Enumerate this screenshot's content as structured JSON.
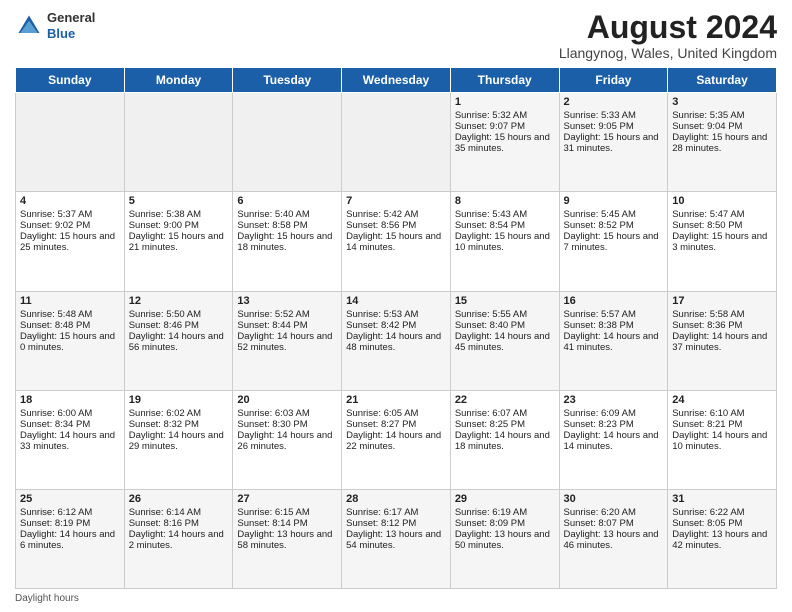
{
  "header": {
    "logo_line1": "General",
    "logo_line2": "Blue",
    "main_title": "August 2024",
    "subtitle": "Llangynog, Wales, United Kingdom"
  },
  "days_of_week": [
    "Sunday",
    "Monday",
    "Tuesday",
    "Wednesday",
    "Thursday",
    "Friday",
    "Saturday"
  ],
  "weeks": [
    [
      {
        "day": "",
        "sunrise": "",
        "sunset": "",
        "daylight": ""
      },
      {
        "day": "",
        "sunrise": "",
        "sunset": "",
        "daylight": ""
      },
      {
        "day": "",
        "sunrise": "",
        "sunset": "",
        "daylight": ""
      },
      {
        "day": "",
        "sunrise": "",
        "sunset": "",
        "daylight": ""
      },
      {
        "day": "1",
        "sunrise": "Sunrise: 5:32 AM",
        "sunset": "Sunset: 9:07 PM",
        "daylight": "Daylight: 15 hours and 35 minutes."
      },
      {
        "day": "2",
        "sunrise": "Sunrise: 5:33 AM",
        "sunset": "Sunset: 9:05 PM",
        "daylight": "Daylight: 15 hours and 31 minutes."
      },
      {
        "day": "3",
        "sunrise": "Sunrise: 5:35 AM",
        "sunset": "Sunset: 9:04 PM",
        "daylight": "Daylight: 15 hours and 28 minutes."
      }
    ],
    [
      {
        "day": "4",
        "sunrise": "Sunrise: 5:37 AM",
        "sunset": "Sunset: 9:02 PM",
        "daylight": "Daylight: 15 hours and 25 minutes."
      },
      {
        "day": "5",
        "sunrise": "Sunrise: 5:38 AM",
        "sunset": "Sunset: 9:00 PM",
        "daylight": "Daylight: 15 hours and 21 minutes."
      },
      {
        "day": "6",
        "sunrise": "Sunrise: 5:40 AM",
        "sunset": "Sunset: 8:58 PM",
        "daylight": "Daylight: 15 hours and 18 minutes."
      },
      {
        "day": "7",
        "sunrise": "Sunrise: 5:42 AM",
        "sunset": "Sunset: 8:56 PM",
        "daylight": "Daylight: 15 hours and 14 minutes."
      },
      {
        "day": "8",
        "sunrise": "Sunrise: 5:43 AM",
        "sunset": "Sunset: 8:54 PM",
        "daylight": "Daylight: 15 hours and 10 minutes."
      },
      {
        "day": "9",
        "sunrise": "Sunrise: 5:45 AM",
        "sunset": "Sunset: 8:52 PM",
        "daylight": "Daylight: 15 hours and 7 minutes."
      },
      {
        "day": "10",
        "sunrise": "Sunrise: 5:47 AM",
        "sunset": "Sunset: 8:50 PM",
        "daylight": "Daylight: 15 hours and 3 minutes."
      }
    ],
    [
      {
        "day": "11",
        "sunrise": "Sunrise: 5:48 AM",
        "sunset": "Sunset: 8:48 PM",
        "daylight": "Daylight: 15 hours and 0 minutes."
      },
      {
        "day": "12",
        "sunrise": "Sunrise: 5:50 AM",
        "sunset": "Sunset: 8:46 PM",
        "daylight": "Daylight: 14 hours and 56 minutes."
      },
      {
        "day": "13",
        "sunrise": "Sunrise: 5:52 AM",
        "sunset": "Sunset: 8:44 PM",
        "daylight": "Daylight: 14 hours and 52 minutes."
      },
      {
        "day": "14",
        "sunrise": "Sunrise: 5:53 AM",
        "sunset": "Sunset: 8:42 PM",
        "daylight": "Daylight: 14 hours and 48 minutes."
      },
      {
        "day": "15",
        "sunrise": "Sunrise: 5:55 AM",
        "sunset": "Sunset: 8:40 PM",
        "daylight": "Daylight: 14 hours and 45 minutes."
      },
      {
        "day": "16",
        "sunrise": "Sunrise: 5:57 AM",
        "sunset": "Sunset: 8:38 PM",
        "daylight": "Daylight: 14 hours and 41 minutes."
      },
      {
        "day": "17",
        "sunrise": "Sunrise: 5:58 AM",
        "sunset": "Sunset: 8:36 PM",
        "daylight": "Daylight: 14 hours and 37 minutes."
      }
    ],
    [
      {
        "day": "18",
        "sunrise": "Sunrise: 6:00 AM",
        "sunset": "Sunset: 8:34 PM",
        "daylight": "Daylight: 14 hours and 33 minutes."
      },
      {
        "day": "19",
        "sunrise": "Sunrise: 6:02 AM",
        "sunset": "Sunset: 8:32 PM",
        "daylight": "Daylight: 14 hours and 29 minutes."
      },
      {
        "day": "20",
        "sunrise": "Sunrise: 6:03 AM",
        "sunset": "Sunset: 8:30 PM",
        "daylight": "Daylight: 14 hours and 26 minutes."
      },
      {
        "day": "21",
        "sunrise": "Sunrise: 6:05 AM",
        "sunset": "Sunset: 8:27 PM",
        "daylight": "Daylight: 14 hours and 22 minutes."
      },
      {
        "day": "22",
        "sunrise": "Sunrise: 6:07 AM",
        "sunset": "Sunset: 8:25 PM",
        "daylight": "Daylight: 14 hours and 18 minutes."
      },
      {
        "day": "23",
        "sunrise": "Sunrise: 6:09 AM",
        "sunset": "Sunset: 8:23 PM",
        "daylight": "Daylight: 14 hours and 14 minutes."
      },
      {
        "day": "24",
        "sunrise": "Sunrise: 6:10 AM",
        "sunset": "Sunset: 8:21 PM",
        "daylight": "Daylight: 14 hours and 10 minutes."
      }
    ],
    [
      {
        "day": "25",
        "sunrise": "Sunrise: 6:12 AM",
        "sunset": "Sunset: 8:19 PM",
        "daylight": "Daylight: 14 hours and 6 minutes."
      },
      {
        "day": "26",
        "sunrise": "Sunrise: 6:14 AM",
        "sunset": "Sunset: 8:16 PM",
        "daylight": "Daylight: 14 hours and 2 minutes."
      },
      {
        "day": "27",
        "sunrise": "Sunrise: 6:15 AM",
        "sunset": "Sunset: 8:14 PM",
        "daylight": "Daylight: 13 hours and 58 minutes."
      },
      {
        "day": "28",
        "sunrise": "Sunrise: 6:17 AM",
        "sunset": "Sunset: 8:12 PM",
        "daylight": "Daylight: 13 hours and 54 minutes."
      },
      {
        "day": "29",
        "sunrise": "Sunrise: 6:19 AM",
        "sunset": "Sunset: 8:09 PM",
        "daylight": "Daylight: 13 hours and 50 minutes."
      },
      {
        "day": "30",
        "sunrise": "Sunrise: 6:20 AM",
        "sunset": "Sunset: 8:07 PM",
        "daylight": "Daylight: 13 hours and 46 minutes."
      },
      {
        "day": "31",
        "sunrise": "Sunrise: 6:22 AM",
        "sunset": "Sunset: 8:05 PM",
        "daylight": "Daylight: 13 hours and 42 minutes."
      }
    ]
  ],
  "footer": {
    "daylight_label": "Daylight hours"
  }
}
